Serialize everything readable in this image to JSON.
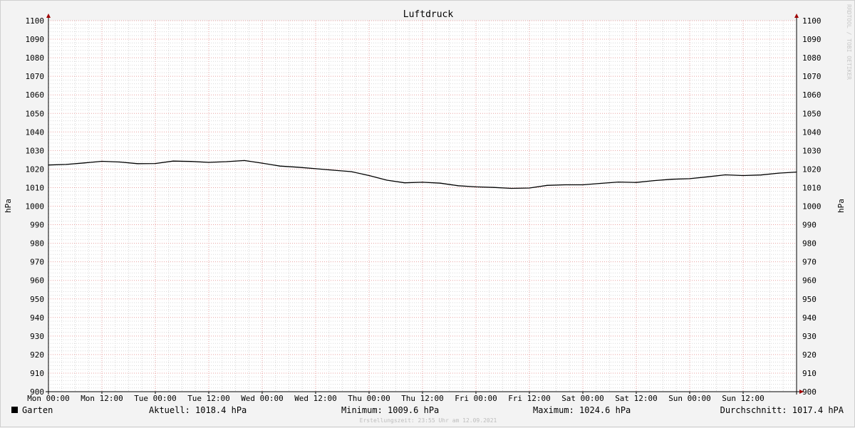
{
  "chart_data": {
    "type": "line",
    "title": "Luftdruck",
    "ylabel_left": "hPa",
    "ylabel_right": "hPa",
    "ylim": [
      900,
      1100
    ],
    "y_ticks": [
      "900",
      "910",
      "920",
      "930",
      "940",
      "950",
      "960",
      "970",
      "980",
      "990",
      "1000",
      "1010",
      "1020",
      "1030",
      "1040",
      "1050",
      "1060",
      "1070",
      "1080",
      "1090",
      "1100"
    ],
    "x_ticks": [
      "Mon 00:00",
      "Mon 12:00",
      "Tue 00:00",
      "Tue 12:00",
      "Wed 00:00",
      "Wed 12:00",
      "Thu 00:00",
      "Thu 12:00",
      "Fri 00:00",
      "Fri 12:00",
      "Sat 00:00",
      "Sat 12:00",
      "Sun 00:00",
      "Sun 12:00"
    ],
    "x_range_hours": [
      0,
      168
    ],
    "grid": true,
    "series": [
      {
        "name": "Garten",
        "color": "#000000",
        "x_hours": [
          0,
          4,
          8,
          12,
          16,
          20,
          24,
          28,
          32,
          36,
          40,
          44,
          48,
          52,
          56,
          60,
          64,
          68,
          72,
          76,
          80,
          84,
          88,
          92,
          96,
          100,
          104,
          108,
          112,
          116,
          120,
          124,
          128,
          132,
          136,
          140,
          144,
          148,
          152,
          156,
          160,
          164,
          168
        ],
        "values": [
          1022.2,
          1022.5,
          1023.3,
          1024.2,
          1023.8,
          1022.9,
          1023.0,
          1024.3,
          1024.1,
          1023.6,
          1024.0,
          1024.6,
          1023.2,
          1021.6,
          1021.0,
          1020.2,
          1019.4,
          1018.6,
          1016.5,
          1014.0,
          1012.6,
          1012.9,
          1012.4,
          1011.0,
          1010.4,
          1010.1,
          1009.6,
          1009.8,
          1011.2,
          1011.5,
          1011.5,
          1012.3,
          1013.0,
          1012.8,
          1013.8,
          1014.5,
          1014.8,
          1015.8,
          1016.9,
          1016.5,
          1016.8,
          1017.8,
          1018.4
        ]
      }
    ]
  },
  "watermark": "RRDTOOL / TOBI OETIKER",
  "legend": {
    "name": "Garten",
    "swatch_color": "#000000",
    "aktuell": "Aktuell: 1018.4 hPa",
    "minimum": "Minimum: 1009.6 hPa",
    "maximum": "Maximum: 1024.6 hPa",
    "durchschnitt": "Durchschnitt: 1017.4 hPA"
  },
  "footer": "Erstellungszeit: 23:55 Uhr am 12.09.2021",
  "colors": {
    "background": "#f3f3f3",
    "canvas": "#ffffff",
    "major_grid": "#e8a0a0",
    "minor_grid": "#d8d8d8",
    "axis": "#000000",
    "arrow": "#a00000"
  }
}
